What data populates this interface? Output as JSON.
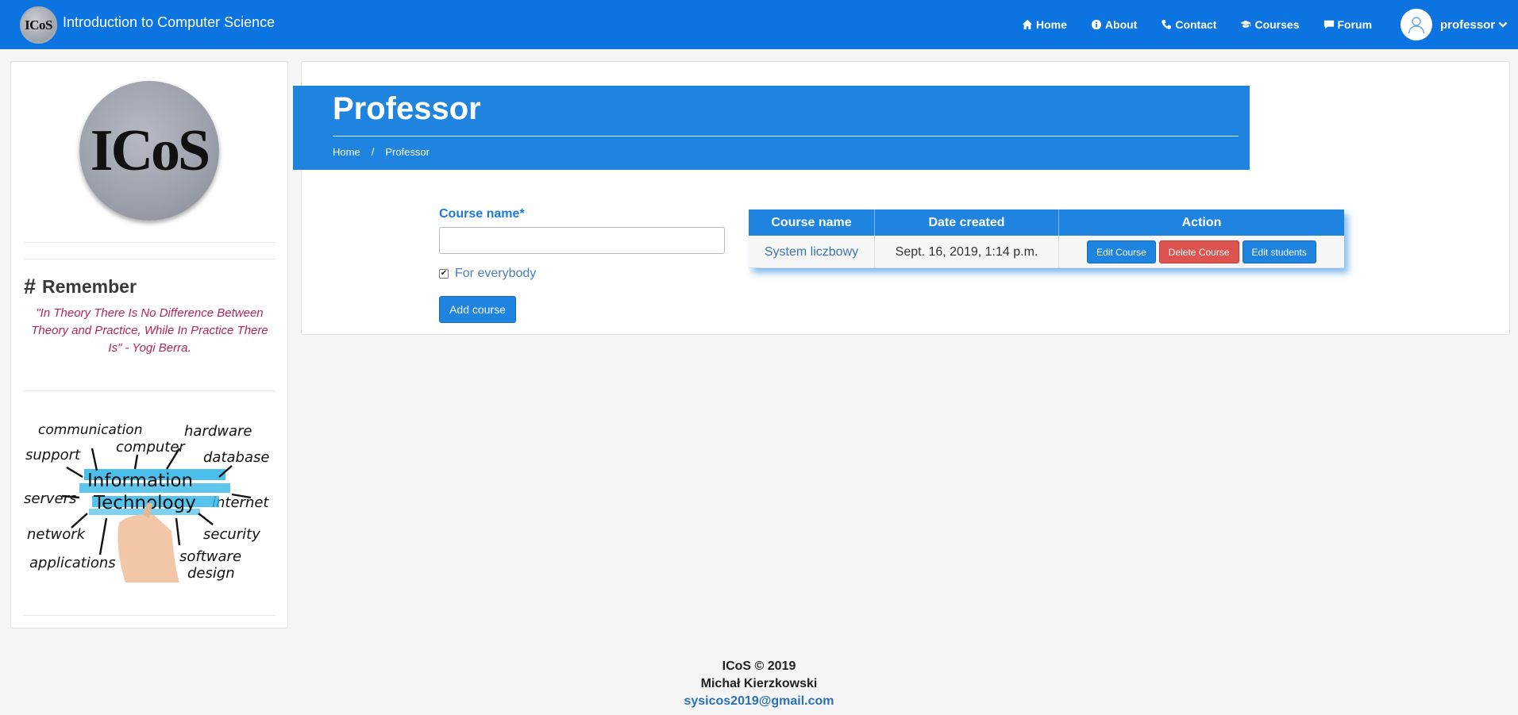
{
  "navbar": {
    "logo_text": "ICoS",
    "title": "Introduction to Computer Science",
    "links": [
      {
        "label": "Home",
        "icon": "home-icon"
      },
      {
        "label": "About",
        "icon": "info-icon"
      },
      {
        "label": "Contact",
        "icon": "phone-icon"
      },
      {
        "label": "Courses",
        "icon": "graduation-cap-icon"
      },
      {
        "label": "Forum",
        "icon": "comment-icon"
      }
    ],
    "user": "professor"
  },
  "sidebar": {
    "logo_text": "ICoS",
    "remember_heading": "Remember",
    "quote": "\"In Theory There Is No Difference Between Theory and Practice, While In Practice There Is\" - Yogi Berra.",
    "it_image_words": {
      "center_top": "Information",
      "center_bottom": "Technology",
      "around": [
        "communication",
        "hardware",
        "computer",
        "support",
        "database",
        "servers",
        "internet",
        "network",
        "security",
        "applications",
        "software",
        "design"
      ]
    }
  },
  "header": {
    "title": "Professor",
    "breadcrumb": [
      "Home",
      "Professor"
    ],
    "breadcrumb_separator": "/"
  },
  "form": {
    "course_label": "Course name*",
    "course_value": "",
    "for_everybody_label": "For everybody",
    "for_everybody_checked": true,
    "add_button": "Add course"
  },
  "table": {
    "headers": [
      "Course name",
      "Date created",
      "Action"
    ],
    "rows": [
      {
        "course": "System liczbowy",
        "date": "Sept. 16, 2019, 1:14 p.m.",
        "actions": [
          "Edit Course",
          "Delete Course",
          "Edit students"
        ]
      }
    ]
  },
  "footer": {
    "line1": "ICoS © 2019",
    "line2": "Michał Kierzkowski",
    "email": "sysicos2019@gmail.com"
  },
  "colors": {
    "primary": "#0b74e0",
    "banner": "#1e84e0",
    "danger": "#dc5350",
    "quote": "#b5245a"
  }
}
